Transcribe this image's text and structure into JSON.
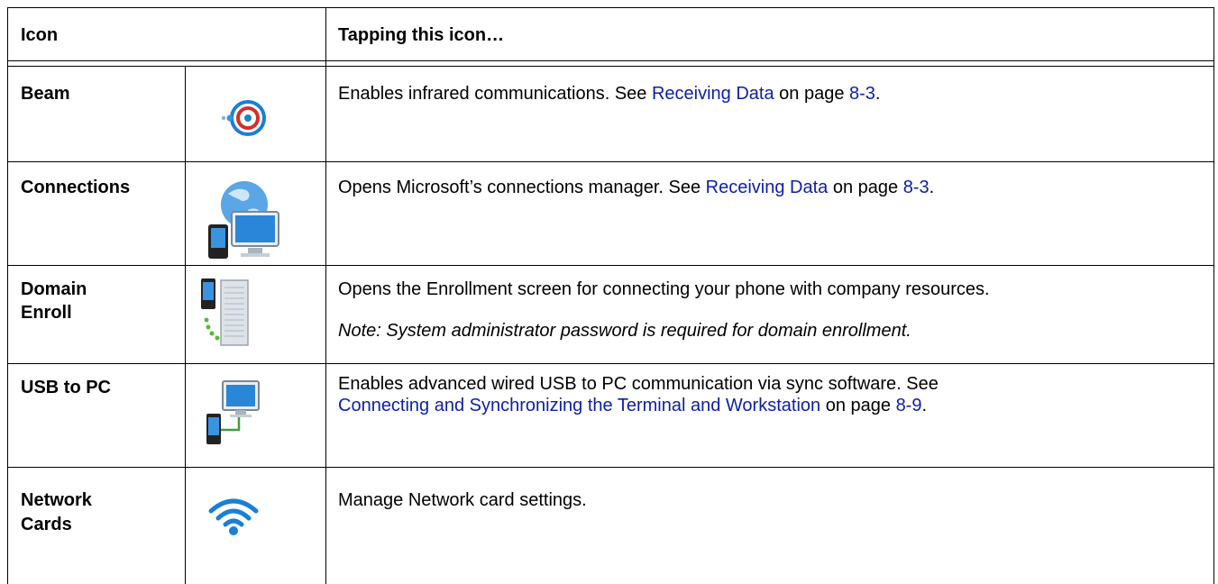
{
  "header": {
    "col1": "Icon",
    "col2": "Tapping this icon…"
  },
  "rows": [
    {
      "name": "Beam",
      "icon": "beam-icon",
      "desc_pre": "Enables infrared communications. See ",
      "link": "Receiving Data",
      "mid": " on page ",
      "page": "8-3",
      "end": "."
    },
    {
      "name": "Connections",
      "icon": "connections-icon",
      "desc_pre": "Opens Microsoft’s connections manager. See ",
      "link": "Receiving Data",
      "mid": " on page ",
      "page": "8-3",
      "end": "."
    },
    {
      "name1": "Domain",
      "name2": "Enroll",
      "icon": "domain-enroll-icon",
      "desc": "Opens the Enrollment screen for connecting your phone with company resources.",
      "note": "Note: System administrator password is required for domain enrollment."
    },
    {
      "name": "USB to PC",
      "icon": "usb-to-pc-icon",
      "desc": "Enables advanced wired USB to PC communication via sync software. See",
      "link": "Connecting and Synchronizing the Terminal and Workstation",
      "mid": " on page ",
      "page": "8-9",
      "end": "."
    },
    {
      "name1": "Network",
      "name2": "Cards",
      "icon": "network-cards-icon",
      "desc": "Manage Network card settings."
    }
  ]
}
